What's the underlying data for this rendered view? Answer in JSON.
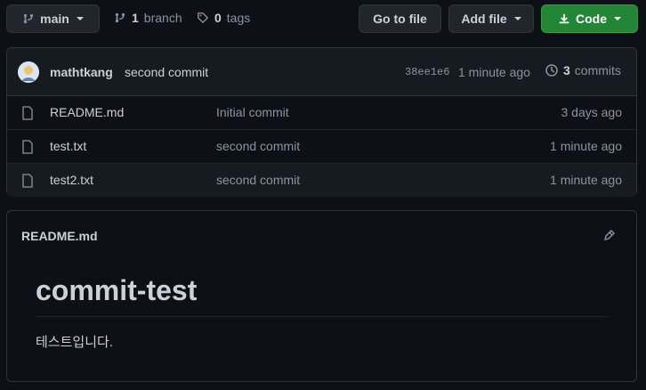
{
  "toolbar": {
    "branch_button": "main",
    "branch_count": "1",
    "branch_label": "branch",
    "tag_count": "0",
    "tag_label": "tags",
    "go_to_file": "Go to file",
    "add_file": "Add file",
    "code": "Code"
  },
  "commit": {
    "author": "mathtkang",
    "message": "second commit",
    "sha": "38ee1e6",
    "time": "1 minute ago",
    "commit_count": "3",
    "commit_label": "commits"
  },
  "files": [
    {
      "name": "README.md",
      "message": "Initial commit",
      "time": "3 days ago",
      "icon": "file-icon"
    },
    {
      "name": "test.txt",
      "message": "second commit",
      "time": "1 minute ago",
      "icon": "file-icon"
    },
    {
      "name": "test2.txt",
      "message": "second commit",
      "time": "1 minute ago",
      "icon": "file-icon"
    }
  ],
  "readme": {
    "filename": "README.md",
    "heading": "commit-test",
    "body": "테스트입니다."
  },
  "colors": {
    "background": "#0d1117",
    "panel": "#161b22",
    "border": "#30363d",
    "code_button": "#238636",
    "text": "#c9d1d9",
    "muted": "#8b949e"
  }
}
